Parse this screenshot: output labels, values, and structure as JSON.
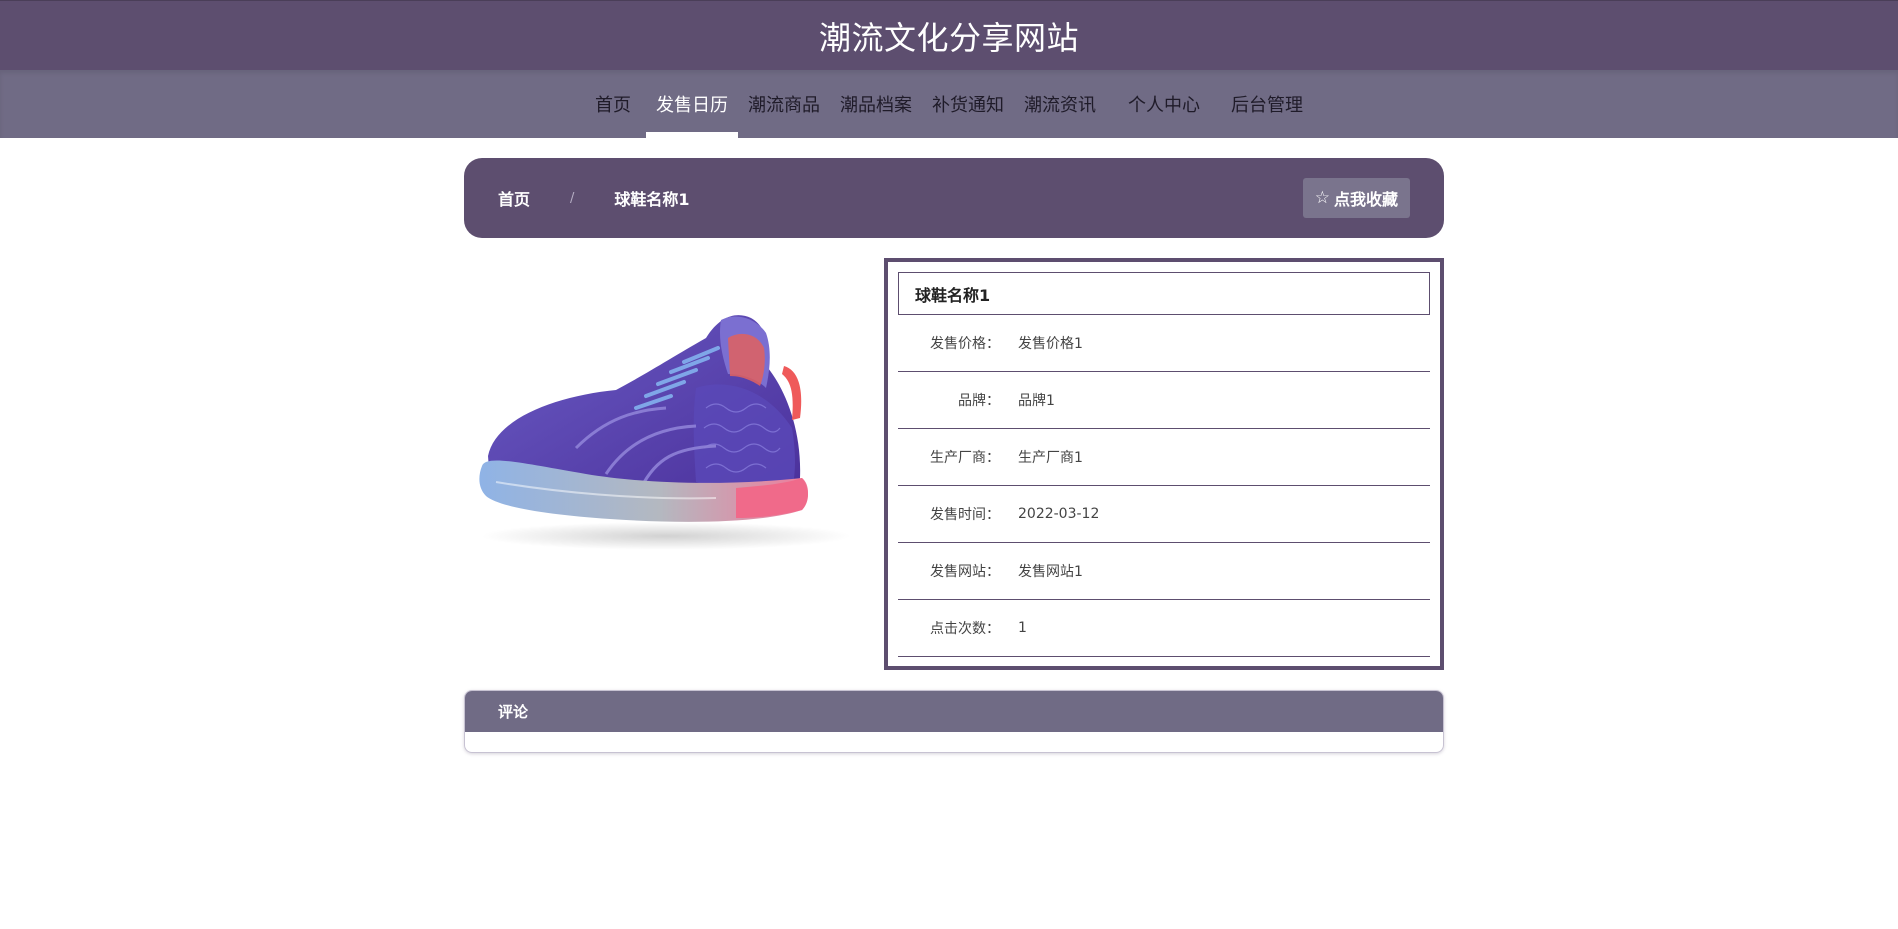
{
  "header": {
    "site_title": "潮流文化分享网站"
  },
  "nav": {
    "items": [
      {
        "label": "首页",
        "active": false
      },
      {
        "label": "发售日历",
        "active": true
      },
      {
        "label": "潮流商品",
        "active": false
      },
      {
        "label": "潮品档案",
        "active": false
      },
      {
        "label": "补货通知",
        "active": false
      },
      {
        "label": "潮流资讯",
        "active": false
      },
      {
        "label": "个人中心",
        "active": false
      },
      {
        "label": "后台管理",
        "active": false
      }
    ]
  },
  "breadcrumb": {
    "home": "首页",
    "separator": "/",
    "current": "球鞋名称1",
    "favorite_label": "点我收藏",
    "favorite_icon": "star-outline-icon"
  },
  "product": {
    "title": "球鞋名称1",
    "fields": [
      {
        "label": "发售价格：",
        "value": "发售价格1"
      },
      {
        "label": "品牌：",
        "value": "品牌1"
      },
      {
        "label": "生产厂商：",
        "value": "生产厂商1"
      },
      {
        "label": "发售时间：",
        "value": "2022-03-12"
      },
      {
        "label": "发售网站：",
        "value": "发售网站1"
      },
      {
        "label": "点击次数：",
        "value": "1"
      }
    ]
  },
  "comments": {
    "title": "评论"
  },
  "colors": {
    "primary": "#5d4e6f",
    "nav_bg": "#706b85",
    "white": "#ffffff"
  }
}
